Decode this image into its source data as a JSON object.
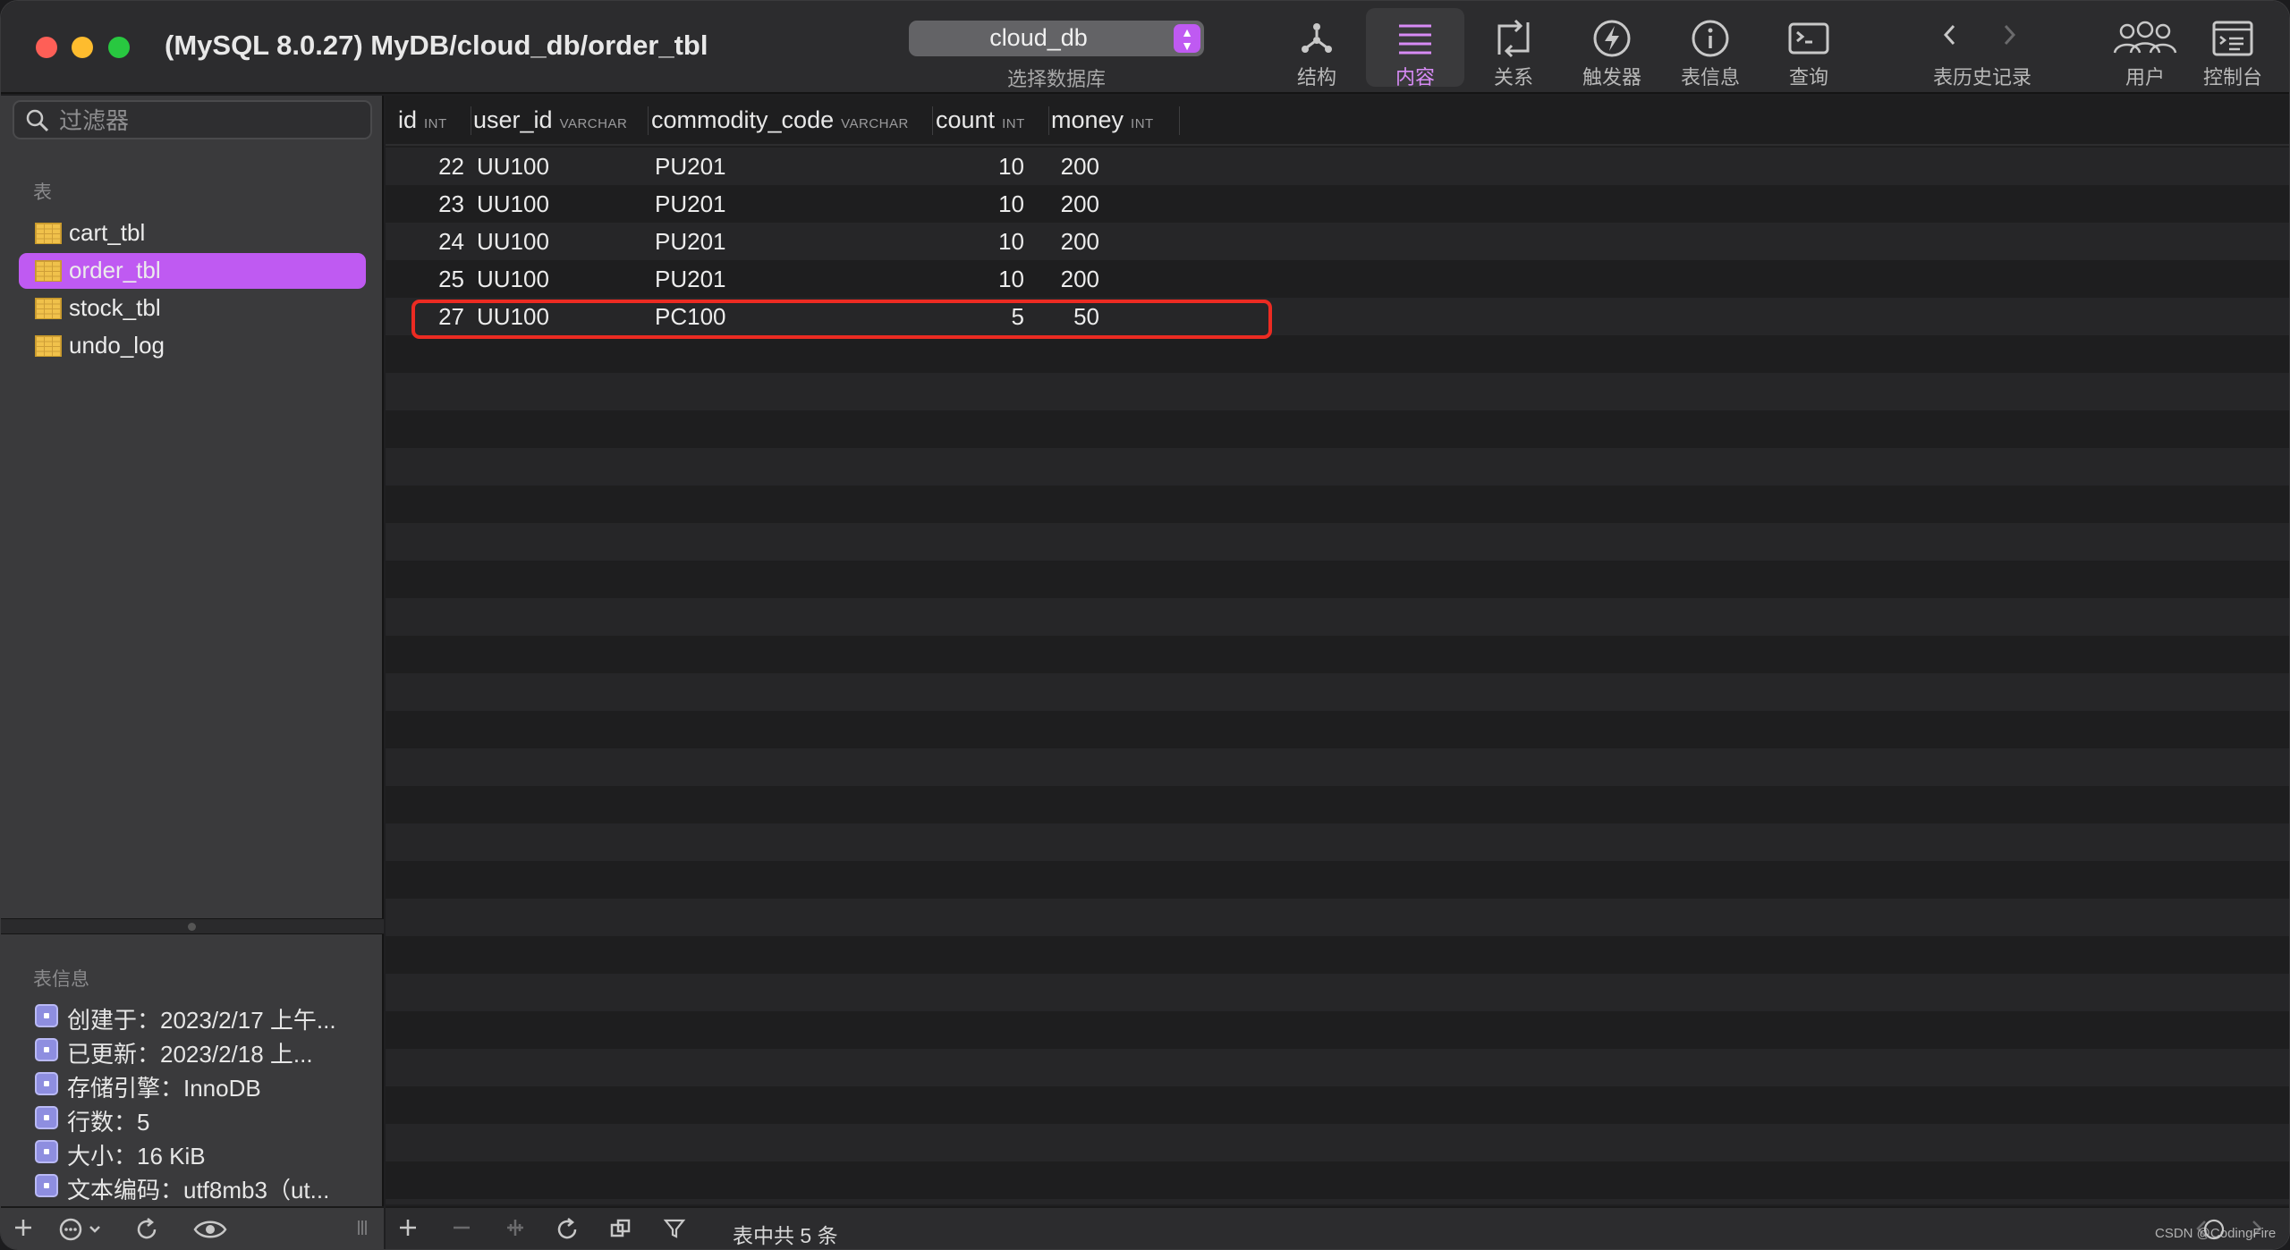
{
  "window": {
    "title": "(MySQL 8.0.27) MyDB/cloud_db/order_tbl"
  },
  "toolbar": {
    "database_select": {
      "value": "cloud_db",
      "label": "选择数据库"
    },
    "buttons": [
      {
        "label": "结构",
        "icon": "structure-icon"
      },
      {
        "label": "内容",
        "icon": "content-icon",
        "active": true
      },
      {
        "label": "关系",
        "icon": "relations-icon"
      },
      {
        "label": "触发器",
        "icon": "triggers-icon"
      },
      {
        "label": "表信息",
        "icon": "table-info-icon"
      },
      {
        "label": "查询",
        "icon": "query-icon"
      }
    ],
    "history": {
      "label": "表历史记录"
    },
    "users": {
      "label": "用户"
    },
    "console": {
      "label": "控制台"
    }
  },
  "sidebar": {
    "filter_placeholder": "过滤器",
    "tables_heading": "表",
    "tables": [
      "cart_tbl",
      "order_tbl",
      "stock_tbl",
      "undo_log"
    ],
    "selected_table": "order_tbl",
    "info_heading": "表信息",
    "info": [
      "创建于：2023/2/17 上午...",
      "已更新：2023/2/18 上...",
      "存储引擎：InnoDB",
      "行数：5",
      "大小：16 KiB",
      "文本编码：utf8mb3（ut..."
    ]
  },
  "grid": {
    "columns": [
      {
        "name": "id",
        "type": "INT"
      },
      {
        "name": "user_id",
        "type": "VARCHAR"
      },
      {
        "name": "commodity_code",
        "type": "VARCHAR"
      },
      {
        "name": "count",
        "type": "INT"
      },
      {
        "name": "money",
        "type": "INT"
      }
    ],
    "rows": [
      [
        "22",
        "UU100",
        "PU201",
        "10",
        "200"
      ],
      [
        "23",
        "UU100",
        "PU201",
        "10",
        "200"
      ],
      [
        "24",
        "UU100",
        "PU201",
        "10",
        "200"
      ],
      [
        "25",
        "UU100",
        "PU201",
        "10",
        "200"
      ],
      [
        "27",
        "UU100",
        "PC100",
        "5",
        "50"
      ]
    ],
    "highlighted_row_index": 4
  },
  "statusbar": {
    "row_count_text": "表中共 5 条",
    "watermark": "CSDN @CodingFire"
  },
  "colors": {
    "accent": "#bf5af2",
    "highlight_border": "#ec2b22"
  }
}
